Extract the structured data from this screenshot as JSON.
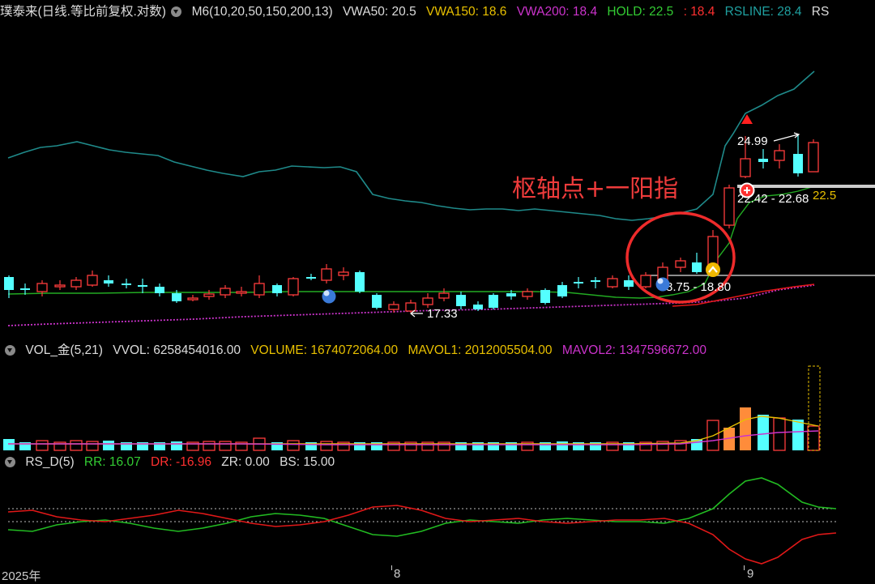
{
  "main_header": {
    "stock": "璞泰来(日线.等比前复权.对数)",
    "indicator": "M6(10,20,50,150,200,13)",
    "vwa50": "VWA50: 20.5",
    "vwa150": "VWA150: 18.6",
    "vwa200": "VWA200: 18.4",
    "hold": "HOLD: 22.5",
    "hold2": ": 18.4",
    "rsline": "RSLINE: 28.4",
    "rs_tail": "RS"
  },
  "vol_header": {
    "indicator": "VOL_金(5,21)",
    "vvol": "VVOL: 6258454016.00",
    "volume": "VOLUME: 1674072064.00",
    "mavol1": "MAVOL1: 2012005504.00",
    "mavol2": "MAVOL2: 1347596672.00"
  },
  "rs_header": {
    "indicator": "RS_D(5)",
    "rr": "RR: 16.07",
    "dr": "DR: -16.96",
    "zr": "ZR: 0.00",
    "bs": "BS: 15.00"
  },
  "annotations": {
    "pivot_text": "枢轴点+一阳指",
    "high_label": "24.99",
    "range_label": "22.42 - 22.68",
    "hold_value": "22.5",
    "pivot_range": "8.75 - 18.80",
    "low_label": "17.33"
  },
  "dates": {
    "year": "2025年",
    "m8": "8",
    "m9": "9"
  },
  "colors": {
    "up": "#ff3c3c",
    "down": "#54ffff",
    "rsline": "#1f8a8a",
    "hold": "#22aa22",
    "vwa200": "#cc33cc",
    "vwa50": "#e01818",
    "orange": "#ff8c3a",
    "yellow": "#f0d000",
    "circle": "#ee2b2b"
  },
  "chart_data": {
    "type": "candlestick",
    "candles": [
      {
        "o": null,
        "c": null,
        "d": 1
      },
      {
        "d": -1
      },
      {
        "d": -1
      },
      {
        "d": 1
      },
      {
        "d": 1
      },
      {
        "d": 1
      },
      {
        "d": -1
      },
      {
        "d": -1
      },
      {
        "d": -1
      },
      {
        "d": -1
      },
      {
        "d": -1
      },
      {
        "d": -1
      },
      {
        "d": 1
      },
      {
        "d": 1
      },
      {
        "d": 1
      },
      {
        "d": 1
      },
      {
        "d": -1
      },
      {
        "d": 1
      },
      {
        "d": 1
      },
      {
        "d": 1
      },
      {
        "d": 1
      },
      {
        "d": -1
      },
      {
        "d": -1
      },
      {
        "d": -1
      },
      {
        "d": 1
      },
      {
        "d": 1
      },
      {
        "d": 1
      },
      {
        "d": -1
      },
      {
        "d": 1
      },
      {
        "d": -1
      },
      {
        "d": -1
      },
      {
        "d": -1
      },
      {
        "d": 1
      },
      {
        "d": -1
      },
      {
        "d": -1
      },
      {
        "d": -1
      },
      {
        "d": -1
      },
      {
        "d": -1
      },
      {
        "d": 1
      },
      {
        "d": -1
      },
      {
        "d": 1
      },
      {
        "d": 1
      },
      {
        "d": 1
      },
      {
        "d": -1
      },
      {
        "d": 1
      },
      {
        "d": 1
      },
      {
        "d": 1
      },
      {
        "d": 1
      },
      {
        "d": -1
      },
      {
        "d": -1
      }
    ]
  }
}
